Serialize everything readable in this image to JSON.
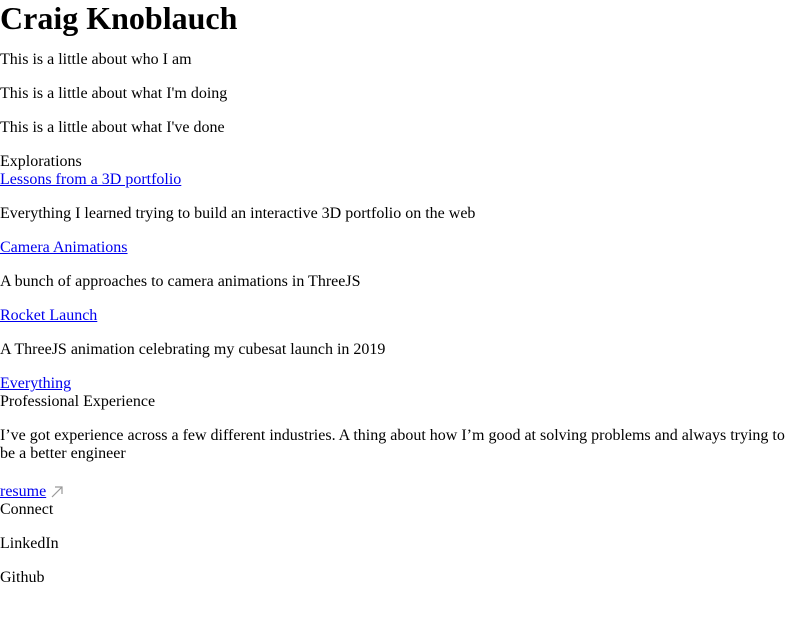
{
  "header": {
    "name": "Craig Knoblauch"
  },
  "intro": {
    "who": "This is a little about who I am",
    "doing": "This is a little about what I'm doing",
    "done": "This is a little about what I've done"
  },
  "explorations": {
    "heading": "Explorations",
    "items": [
      {
        "title": "Lessons from a 3D portfolio",
        "description": "Everything I learned trying to build an interactive 3D portfolio on the web"
      },
      {
        "title": "Camera Animations",
        "description": "A bunch of approaches to camera animations in ThreeJS"
      },
      {
        "title": "Rocket Launch",
        "description": "A ThreeJS animation celebrating my cubesat launch in 2019"
      }
    ],
    "everything_link": "Everything"
  },
  "experience": {
    "heading": "Professional Experience",
    "summary": "I’ve got experience across a few different industries. A thing about how I’m good at solving problems and always trying to be a better engineer",
    "resume_link": "resume",
    "resume_icon": "external-arrow-icon"
  },
  "connect": {
    "heading": "Connect",
    "items": [
      "LinkedIn",
      "Github"
    ]
  },
  "colors": {
    "link": "#0000ee",
    "icon": "#999999"
  }
}
